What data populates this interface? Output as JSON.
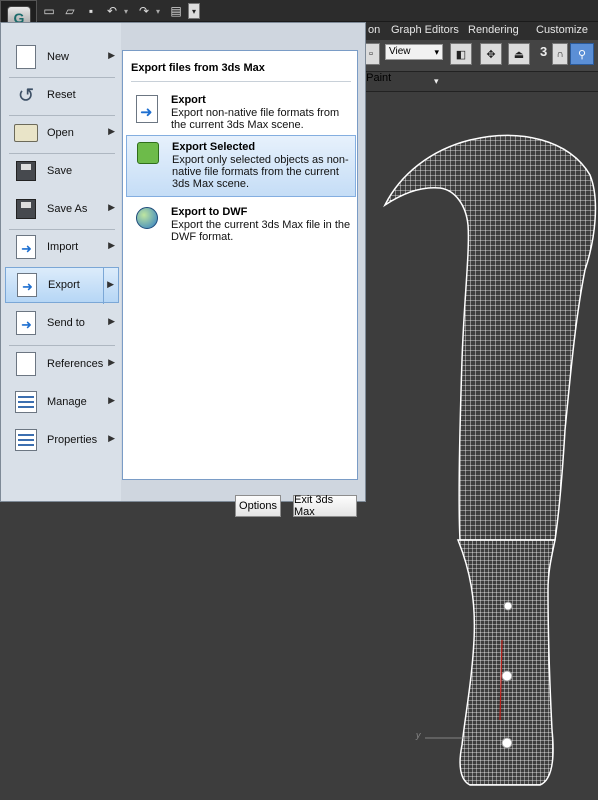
{
  "quick_access": {
    "icons": [
      "new-file-icon",
      "open-folder-icon",
      "save-icon",
      "undo-icon",
      "redo-icon",
      "project-folder-icon"
    ],
    "more": "▾"
  },
  "menubar": {
    "items": [
      "Graph Editors",
      "Rendering",
      "Customize"
    ],
    "partial_item": "on"
  },
  "toolbar": {
    "view_select": "View",
    "number_label": "3"
  },
  "ribbon2": {
    "label": "t Paint",
    "button": "▾"
  },
  "app_menu": {
    "logo_letter": "G",
    "items": [
      {
        "label": "New",
        "has_arrow": true
      },
      {
        "label": "Reset",
        "has_arrow": false
      },
      {
        "label": "Open",
        "has_arrow": true
      },
      {
        "label": "Save",
        "has_arrow": false
      },
      {
        "label": "Save As",
        "has_arrow": true
      },
      {
        "label": "Import",
        "has_arrow": true
      },
      {
        "label": "Export",
        "has_arrow": true,
        "selected": true
      },
      {
        "label": "Send to",
        "has_arrow": true
      },
      {
        "label": "References",
        "has_arrow": true
      },
      {
        "label": "Manage",
        "has_arrow": true
      },
      {
        "label": "Properties",
        "has_arrow": true
      }
    ],
    "arrow_glyph": "▶"
  },
  "export_panel": {
    "heading": "Export files from 3ds Max",
    "items": [
      {
        "title": "Export",
        "description": "Export non-native file formats from the current 3ds Max scene."
      },
      {
        "title": "Export Selected",
        "description": "Export only selected objects as non-native file formats from the current 3ds Max scene."
      },
      {
        "title": "Export to DWF",
        "description": "Export the current 3ds Max file in the DWF format."
      }
    ]
  },
  "footer": {
    "options_label": "Options",
    "exit_label": "Exit 3ds Max"
  },
  "viewport": {
    "axis_label": "y"
  },
  "colors": {
    "menu_bg": "#d9e0e8",
    "selection": "#b6d6f5",
    "viewport_bg": "#3d3d3d",
    "wireframe": "#ffffff",
    "accent_red": "#c0201a"
  }
}
